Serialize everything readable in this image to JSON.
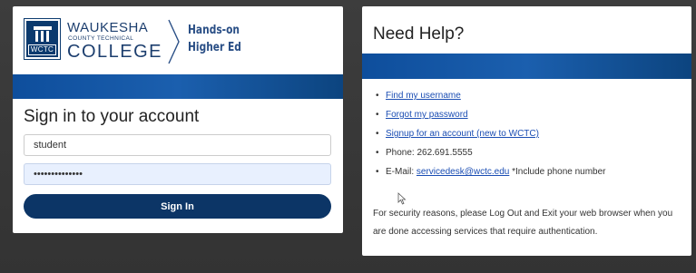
{
  "login": {
    "logo": {
      "box_text": "WCTC",
      "name_line1": "WAUKESHA",
      "name_line2": "COUNTY TECHNICAL",
      "name_line3": "COLLEGE",
      "tagline_line1": "Hands-on",
      "tagline_line2": "Higher Ed"
    },
    "title": "Sign in to your account",
    "username_value": "student",
    "password_mask": "••••••••••••••",
    "submit_label": "Sign In"
  },
  "help": {
    "title": "Need Help?",
    "links": [
      {
        "label": "Find my username"
      },
      {
        "label": "Forgot my password"
      },
      {
        "label": "Signup for an account (new to WCTC)"
      }
    ],
    "phone_text": "Phone: 262.691.5555",
    "email_prefix": "E-Mail: ",
    "email_link": "servicedesk@wctc.edu",
    "email_suffix": " *Include phone number",
    "security_note": "For security reasons, please Log Out and Exit your web browser when you are done accessing services that require authentication."
  },
  "colors": {
    "brand_navy": "#0c3566",
    "brand_blue": "#1b5fae",
    "link": "#1a4db3"
  }
}
